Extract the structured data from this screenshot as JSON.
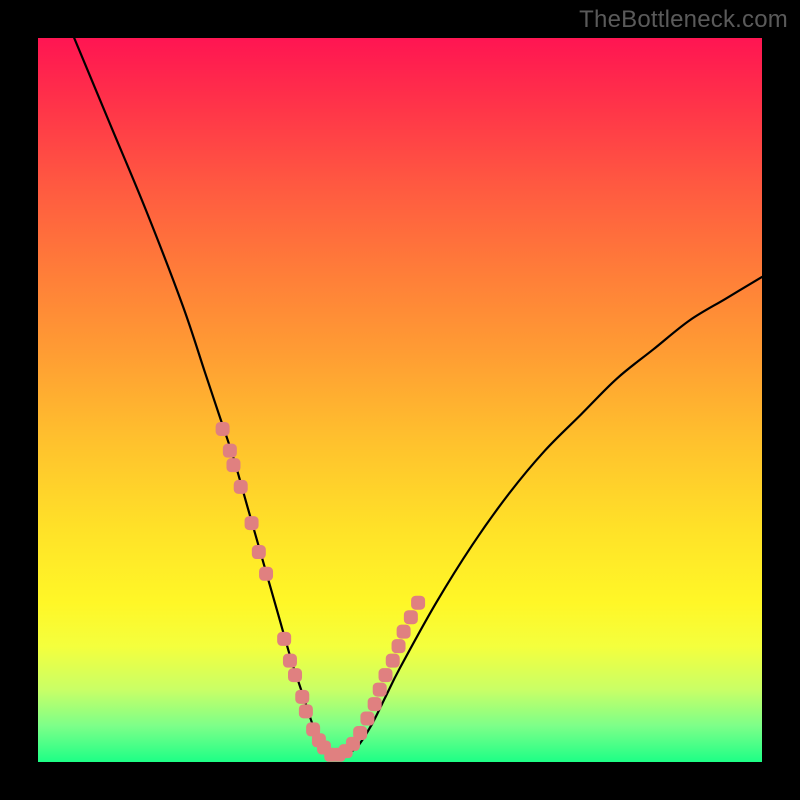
{
  "watermark": "TheBottleneck.com",
  "colors": {
    "curve_stroke": "#000000",
    "marker_fill": "#e08080",
    "marker_stroke": "#e08080"
  },
  "chart_data": {
    "type": "line",
    "title": "",
    "xlabel": "",
    "ylabel": "",
    "xlim": [
      0,
      100
    ],
    "ylim": [
      0,
      100
    ],
    "series": [
      {
        "name": "curve",
        "x": [
          5,
          10,
          15,
          20,
          23,
          25,
          27,
          29,
          31,
          33,
          35,
          36,
          37,
          38,
          39,
          40,
          42,
          44,
          46,
          48,
          50,
          55,
          60,
          65,
          70,
          75,
          80,
          85,
          90,
          95,
          100
        ],
        "values": [
          100,
          88,
          76,
          63,
          54,
          48,
          42,
          35,
          28,
          21,
          14,
          11,
          8,
          5,
          3,
          1,
          1,
          2,
          5,
          9,
          13,
          22,
          30,
          37,
          43,
          48,
          53,
          57,
          61,
          64,
          67
        ]
      }
    ],
    "markers": [
      {
        "x": 25.5,
        "y": 46
      },
      {
        "x": 26.5,
        "y": 43
      },
      {
        "x": 27.0,
        "y": 41
      },
      {
        "x": 28.0,
        "y": 38
      },
      {
        "x": 29.5,
        "y": 33
      },
      {
        "x": 30.5,
        "y": 29
      },
      {
        "x": 31.5,
        "y": 26
      },
      {
        "x": 34.0,
        "y": 17
      },
      {
        "x": 34.8,
        "y": 14
      },
      {
        "x": 35.5,
        "y": 12
      },
      {
        "x": 36.5,
        "y": 9
      },
      {
        "x": 37.0,
        "y": 7
      },
      {
        "x": 38.0,
        "y": 4.5
      },
      {
        "x": 38.8,
        "y": 3
      },
      {
        "x": 39.5,
        "y": 2
      },
      {
        "x": 40.5,
        "y": 1
      },
      {
        "x": 41.5,
        "y": 1
      },
      {
        "x": 42.5,
        "y": 1.5
      },
      {
        "x": 43.5,
        "y": 2.5
      },
      {
        "x": 44.5,
        "y": 4
      },
      {
        "x": 45.5,
        "y": 6
      },
      {
        "x": 46.5,
        "y": 8
      },
      {
        "x": 47.2,
        "y": 10
      },
      {
        "x": 48.0,
        "y": 12
      },
      {
        "x": 49.0,
        "y": 14
      },
      {
        "x": 49.8,
        "y": 16
      },
      {
        "x": 50.5,
        "y": 18
      },
      {
        "x": 51.5,
        "y": 20
      },
      {
        "x": 52.5,
        "y": 22
      }
    ]
  }
}
